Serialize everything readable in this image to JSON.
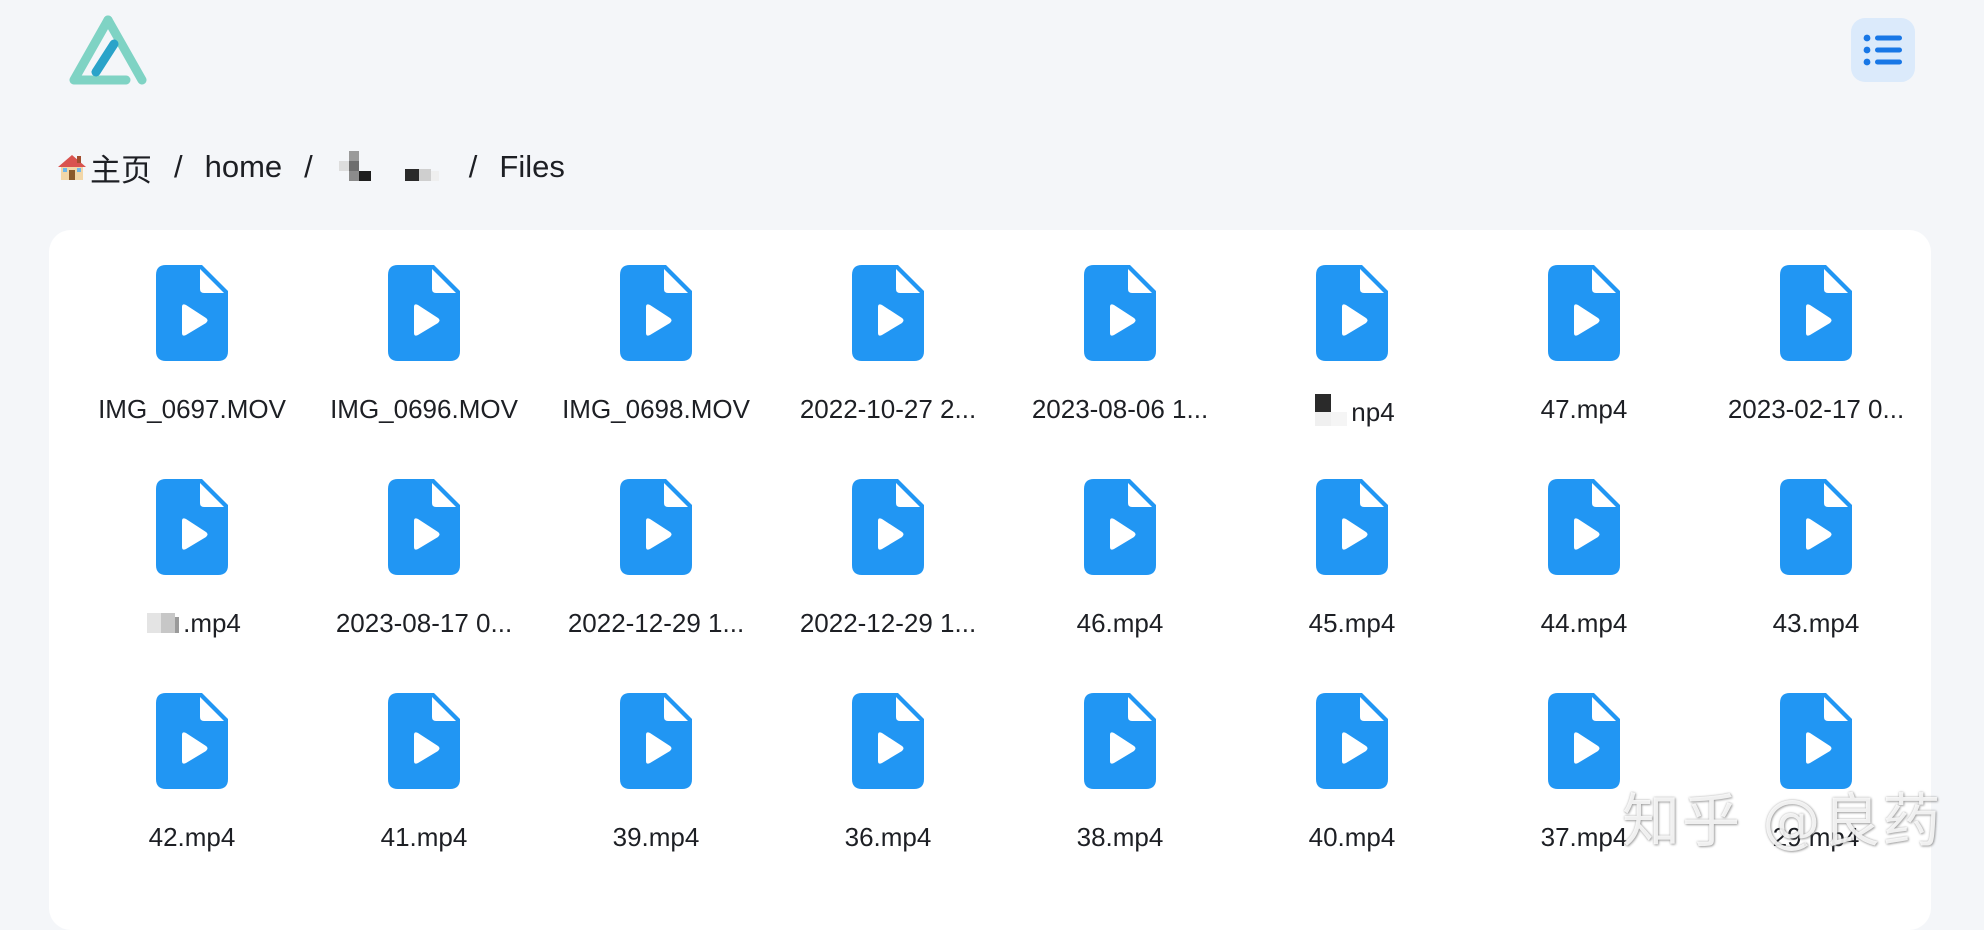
{
  "header": {
    "logo_icon": "app-logo-icon",
    "list_view_icon": "list-view-icon",
    "accent_color": "#2196f3",
    "logo_colors": [
      "#7fd3c4",
      "#2aa3c9"
    ]
  },
  "breadcrumb": {
    "items": [
      {
        "label": "主页",
        "icon": "house-emoji-icon"
      },
      {
        "label": "home"
      },
      {
        "label": "",
        "redacted": true
      },
      {
        "label": "Files"
      }
    ],
    "separator": "/"
  },
  "files": [
    {
      "name": "IMG_0697.MOV"
    },
    {
      "name": "IMG_0696.MOV"
    },
    {
      "name": "IMG_0698.MOV"
    },
    {
      "name": "2022-10-27 2..."
    },
    {
      "name": "2023-08-06 1..."
    },
    {
      "name": "np4",
      "redacted_prefix": true
    },
    {
      "name": "47.mp4"
    },
    {
      "name": "2023-02-17 0..."
    },
    {
      "name": ".mp4",
      "redacted_prefix": true
    },
    {
      "name": "2023-08-17 0..."
    },
    {
      "name": "2022-12-29 1..."
    },
    {
      "name": "2022-12-29 1..."
    },
    {
      "name": "46.mp4"
    },
    {
      "name": "45.mp4"
    },
    {
      "name": "44.mp4"
    },
    {
      "name": "43.mp4"
    },
    {
      "name": "42.mp4"
    },
    {
      "name": "41.mp4"
    },
    {
      "name": "39.mp4"
    },
    {
      "name": "36.mp4"
    },
    {
      "name": "38.mp4"
    },
    {
      "name": "40.mp4"
    },
    {
      "name": "37.mp4"
    },
    {
      "name": "29.mp4"
    }
  ],
  "file_icon": "video-file-icon",
  "watermark": "知乎 @良药"
}
